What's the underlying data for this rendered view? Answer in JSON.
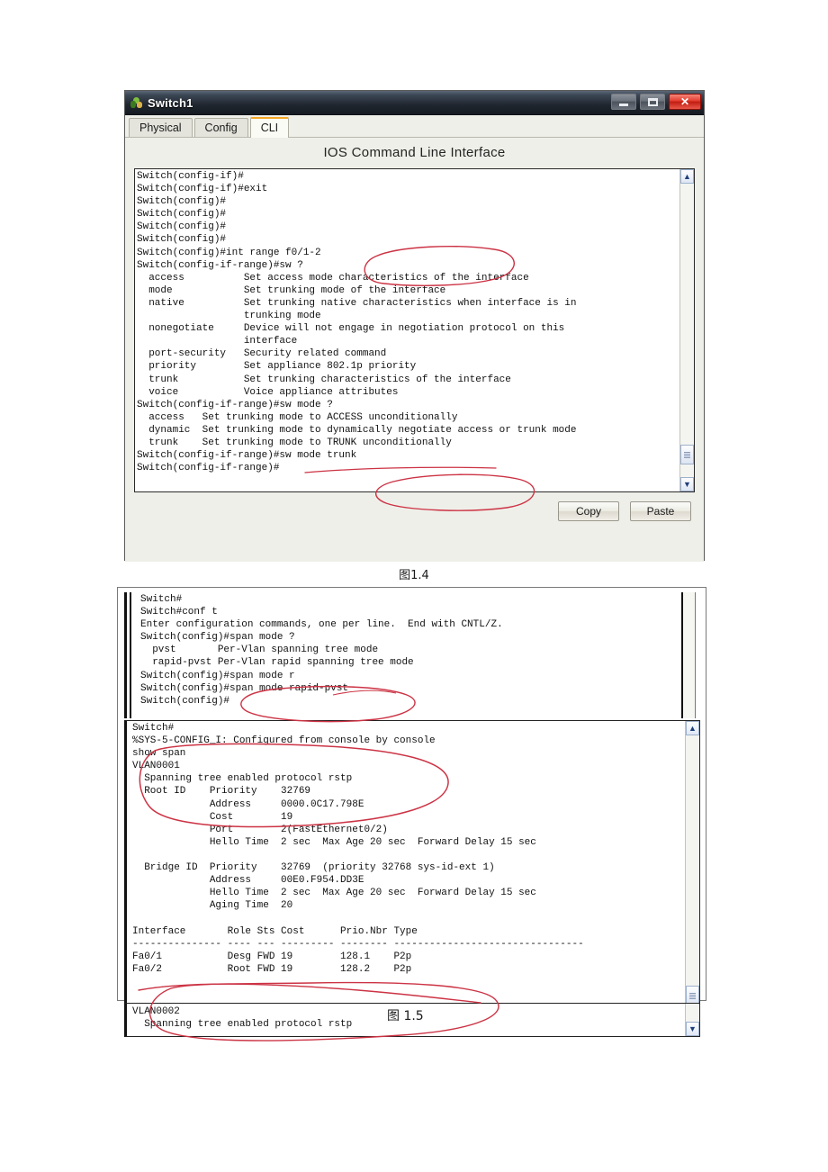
{
  "page": {
    "background": "#ffffff"
  },
  "figure_1_4": {
    "caption": "图1.4",
    "window": {
      "title": "Switch1",
      "app_icon": "packet-tracer-icon",
      "controls": {
        "minimize": "–",
        "maximize": "❐",
        "close": "✕"
      },
      "tabs": [
        {
          "label": "Physical",
          "active": false
        },
        {
          "label": "Config",
          "active": false
        },
        {
          "label": "CLI",
          "active": true
        }
      ],
      "heading": "IOS Command Line Interface",
      "buttons": [
        {
          "label": "Copy"
        },
        {
          "label": "Paste"
        }
      ],
      "scrollbar": {
        "up_arrow": "▲",
        "down_arrow": "▼",
        "thumb_position_pct": 88
      },
      "console_text": "Switch(config-if)#\nSwitch(config-if)#exit\nSwitch(config)#\nSwitch(config)#\nSwitch(config)#\nSwitch(config)#\nSwitch(config)#int range f0/1-2\nSwitch(config-if-range)#sw ?\n  access          Set access mode characteristics of the interface\n  mode            Set trunking mode of the interface\n  native          Set trunking native characteristics when interface is in\n                  trunking mode\n  nonegotiate     Device will not engage in negotiation protocol on this\n                  interface\n  port-security   Security related command\n  priority        Set appliance 802.1p priority\n  trunk           Set trunking characteristics of the interface\n  voice           Voice appliance attributes\nSwitch(config-if-range)#sw mode ?\n  access   Set trunking mode to ACCESS unconditionally\n  dynamic  Set trunking mode to dynamically negotiate access or trunk mode\n  trunk    Set trunking mode to TRUNK unconditionally\nSwitch(config-if-range)#sw mode trunk\nSwitch(config-if-range)#"
    }
  },
  "figure_1_5": {
    "caption": "图 1.5",
    "capture_top": {
      "console_text": "Switch#\nSwitch#conf t\nEnter configuration commands, one per line.  End with CNTL/Z.\nSwitch(config)#span mode ?\n  pvst       Per-Vlan spanning tree mode\n  rapid-pvst Per-Vlan rapid spanning tree mode\nSwitch(config)#span mode r\nSwitch(config)#span mode rapid-pvst\nSwitch(config)#"
    },
    "capture_bottom": {
      "scrollbar": {
        "up_arrow": "▲",
        "down_arrow": "▼",
        "thumb_position_pct": 92
      },
      "console_text": "Switch#\n%SYS-5-CONFIG_I: Configured from console by console\nshow span\nVLAN0001\n  Spanning tree enabled protocol rstp\n  Root ID    Priority    32769\n             Address     0000.0C17.798E\n             Cost        19\n             Port        2(FastEthernet0/2)\n             Hello Time  2 sec  Max Age 20 sec  Forward Delay 15 sec\n\n  Bridge ID  Priority    32769  (priority 32768 sys-id-ext 1)\n             Address     00E0.F954.DD3E\n             Hello Time  2 sec  Max Age 20 sec  Forward Delay 15 sec\n             Aging Time  20\n\nInterface       Role Sts Cost      Prio.Nbr Type\n--------------- ---- --- --------- -------- --------------------------------\nFa0/1           Desg FWD 19        128.1    P2p\nFa0/2           Root FWD 19        128.2    P2p",
      "footer_text": "VLAN0002\n  Spanning tree enabled protocol rstp"
    }
  },
  "annotations": {
    "color": "#cc3344",
    "marks": [
      "ellipse-around-int-range-command",
      "strike-through-trunk-line",
      "ellipse-around-sw-mode-trunk",
      "ellipse-around-span-mode-rapid-pvst",
      "ellipse-around-rootid-block",
      "underline-fa02-root-row",
      "ellipse-around-vlan0002"
    ]
  }
}
